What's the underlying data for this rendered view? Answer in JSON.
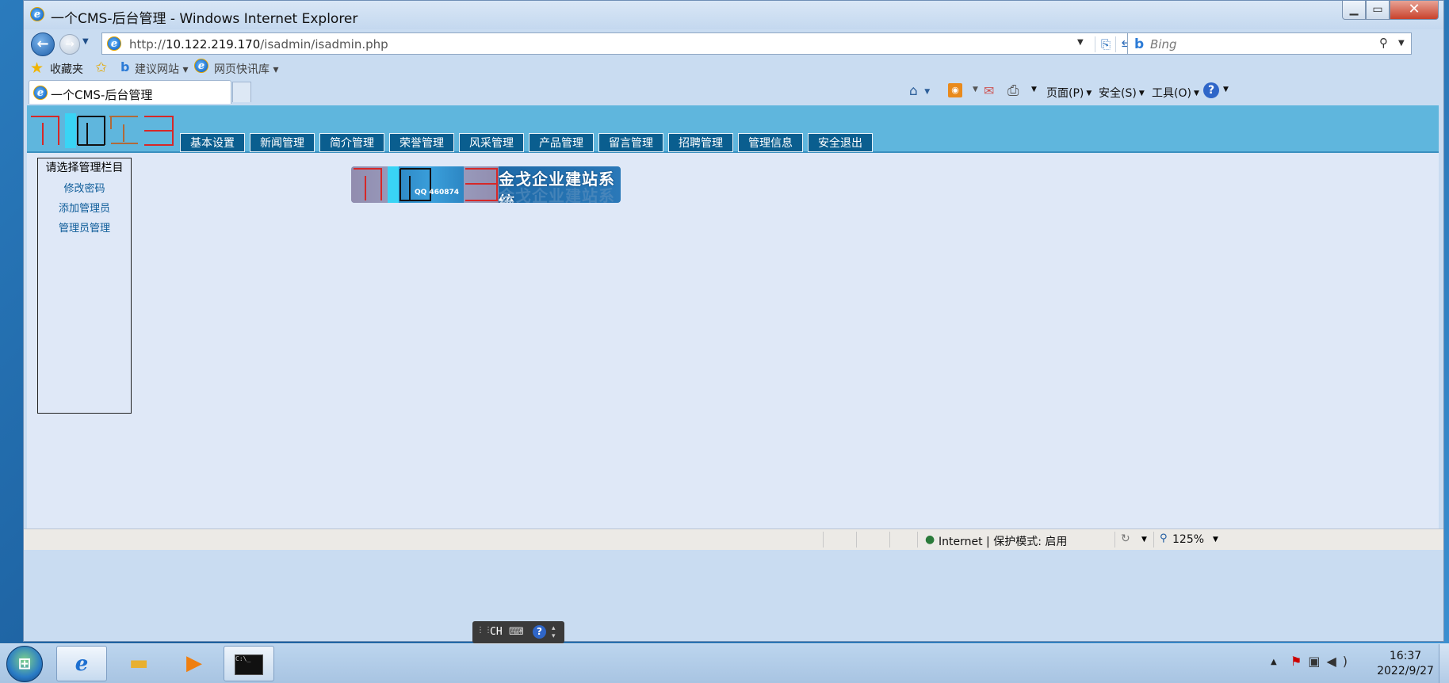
{
  "window": {
    "title": "一个CMS-后台管理 - Windows Internet Explorer",
    "min_glyph": "▁",
    "max_glyph": "▭",
    "close_glyph": "✕"
  },
  "nav": {
    "address_scheme": "http://",
    "address_host": "10.122.219.170",
    "address_path": "/isadmin/isadmin.php",
    "search_placeholder": "Bing"
  },
  "favorites_bar": {
    "favorites_label": "收藏夹",
    "suggested_sites_label": "建议网站 ▾",
    "web_slice_label": "网页快讯库 ▾"
  },
  "tab": {
    "active_label": "一个CMS-后台管理"
  },
  "command_bar": {
    "page_label": "页面(P)",
    "safety_label": "安全(S)",
    "tools_label": "工具(O)",
    "help_glyph": "?"
  },
  "cms": {
    "nav_items": [
      {
        "label": "基本设置"
      },
      {
        "label": "新闻管理"
      },
      {
        "label": "简介管理"
      },
      {
        "label": "荣誉管理"
      },
      {
        "label": "风采管理"
      },
      {
        "label": "产品管理"
      },
      {
        "label": "留言管理"
      },
      {
        "label": "招聘管理"
      },
      {
        "label": "管理信息"
      },
      {
        "label": "安全退出"
      }
    ],
    "side_panel": {
      "title": "请选择管理栏目",
      "links": [
        {
          "label": "修改密码"
        },
        {
          "label": "添加管理员"
        },
        {
          "label": "管理员管理"
        }
      ]
    },
    "banner": {
      "title": "金戈企业建站系统",
      "qq": "QQ 460874"
    }
  },
  "status_bar": {
    "zone_text": "Internet | 保护模式: 启用",
    "zoom": "125%"
  },
  "language_bar": {
    "input_lang": "CH"
  },
  "taskbar": {
    "time": "16:37",
    "date": "2022/9/27"
  },
  "icons": {
    "ie": "ie-icon",
    "back": "back-arrow-icon",
    "forward": "forward-arrow-icon",
    "home": "home-icon",
    "feeds": "rss-icon",
    "mail": "mail-icon",
    "print": "printer-icon",
    "help": "help-icon",
    "start": "windows-start-icon"
  },
  "colors": {
    "cms_header": "#5fb6dd",
    "cms_nav_button": "#0a5e8f",
    "content_bg": "#dfe8f7",
    "link": "#0e5c99"
  }
}
